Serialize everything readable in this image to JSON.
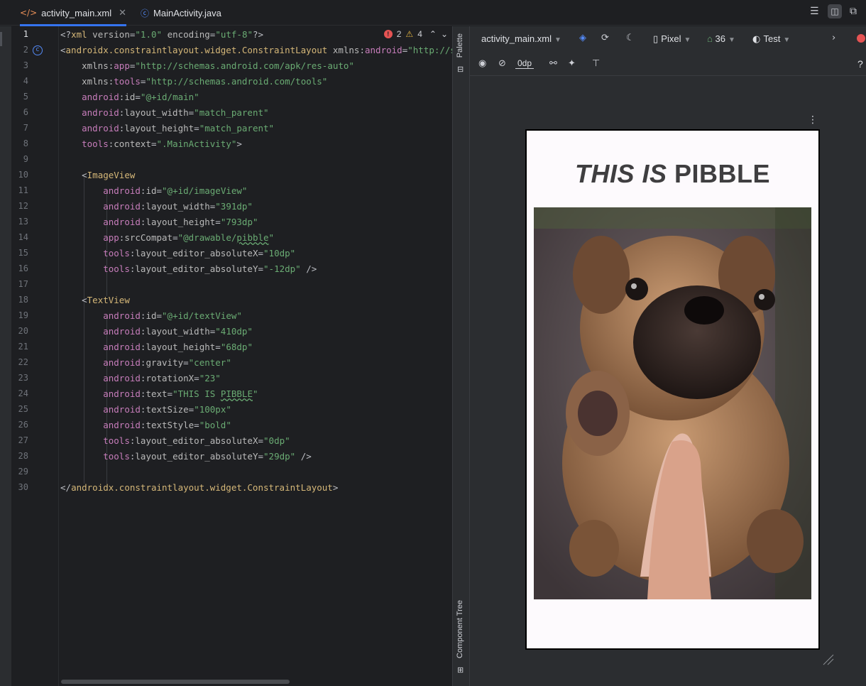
{
  "tabs": [
    {
      "label": "activity_main.xml",
      "icon": "xml-file-icon",
      "active": true
    },
    {
      "label": "MainActivity.java",
      "icon": "java-class-icon",
      "active": false
    }
  ],
  "editor": {
    "inspection": {
      "errors": "2",
      "warnings": "4"
    },
    "line_numbers": [
      "1",
      "2",
      "3",
      "4",
      "5",
      "6",
      "7",
      "8",
      "9",
      "10",
      "11",
      "12",
      "13",
      "14",
      "15",
      "16",
      "17",
      "18",
      "19",
      "20",
      "21",
      "22",
      "23",
      "24",
      "25",
      "26",
      "27",
      "28",
      "29",
      "30"
    ]
  },
  "side_panels": {
    "palette": "Palette",
    "component_tree": "Component Tree"
  },
  "design": {
    "file_dropdown": "activity_main.xml",
    "device": "Pixel",
    "api_level": "36",
    "theme": "Test",
    "margin_default": "0dp",
    "help": "?",
    "preview_text": {
      "italic_part": "THIS IS",
      "rest": " PIBBLE"
    }
  },
  "colors": {
    "accent": "#3574f0",
    "string": "#6aab73",
    "tag": "#d5b778",
    "namespace": "#c77dbb",
    "error": "#e55353",
    "warning": "#e0b341"
  }
}
